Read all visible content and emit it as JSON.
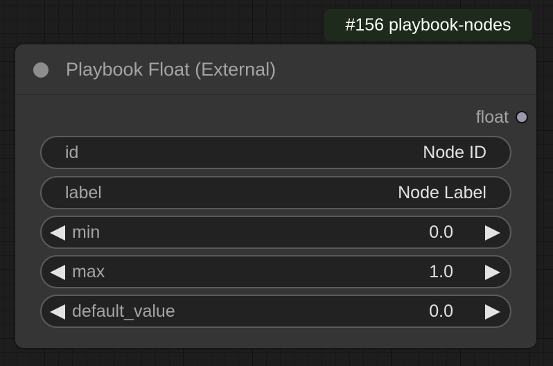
{
  "badge": {
    "text": "#156 playbook-nodes",
    "color": "#1e2a1b"
  },
  "node": {
    "title": "Playbook Float (External)",
    "status_color": "#8e8e8e",
    "output": {
      "label": "float",
      "dot_color": "#9d97ab"
    },
    "widgets": [
      {
        "type": "text",
        "label": "id",
        "value": "Node ID"
      },
      {
        "type": "text",
        "label": "label",
        "value": "Node Label"
      },
      {
        "type": "number",
        "label": "min",
        "value": "0.0"
      },
      {
        "type": "number",
        "label": "max",
        "value": "1.0"
      },
      {
        "type": "number",
        "label": "default_value",
        "value": "0.0"
      }
    ]
  }
}
